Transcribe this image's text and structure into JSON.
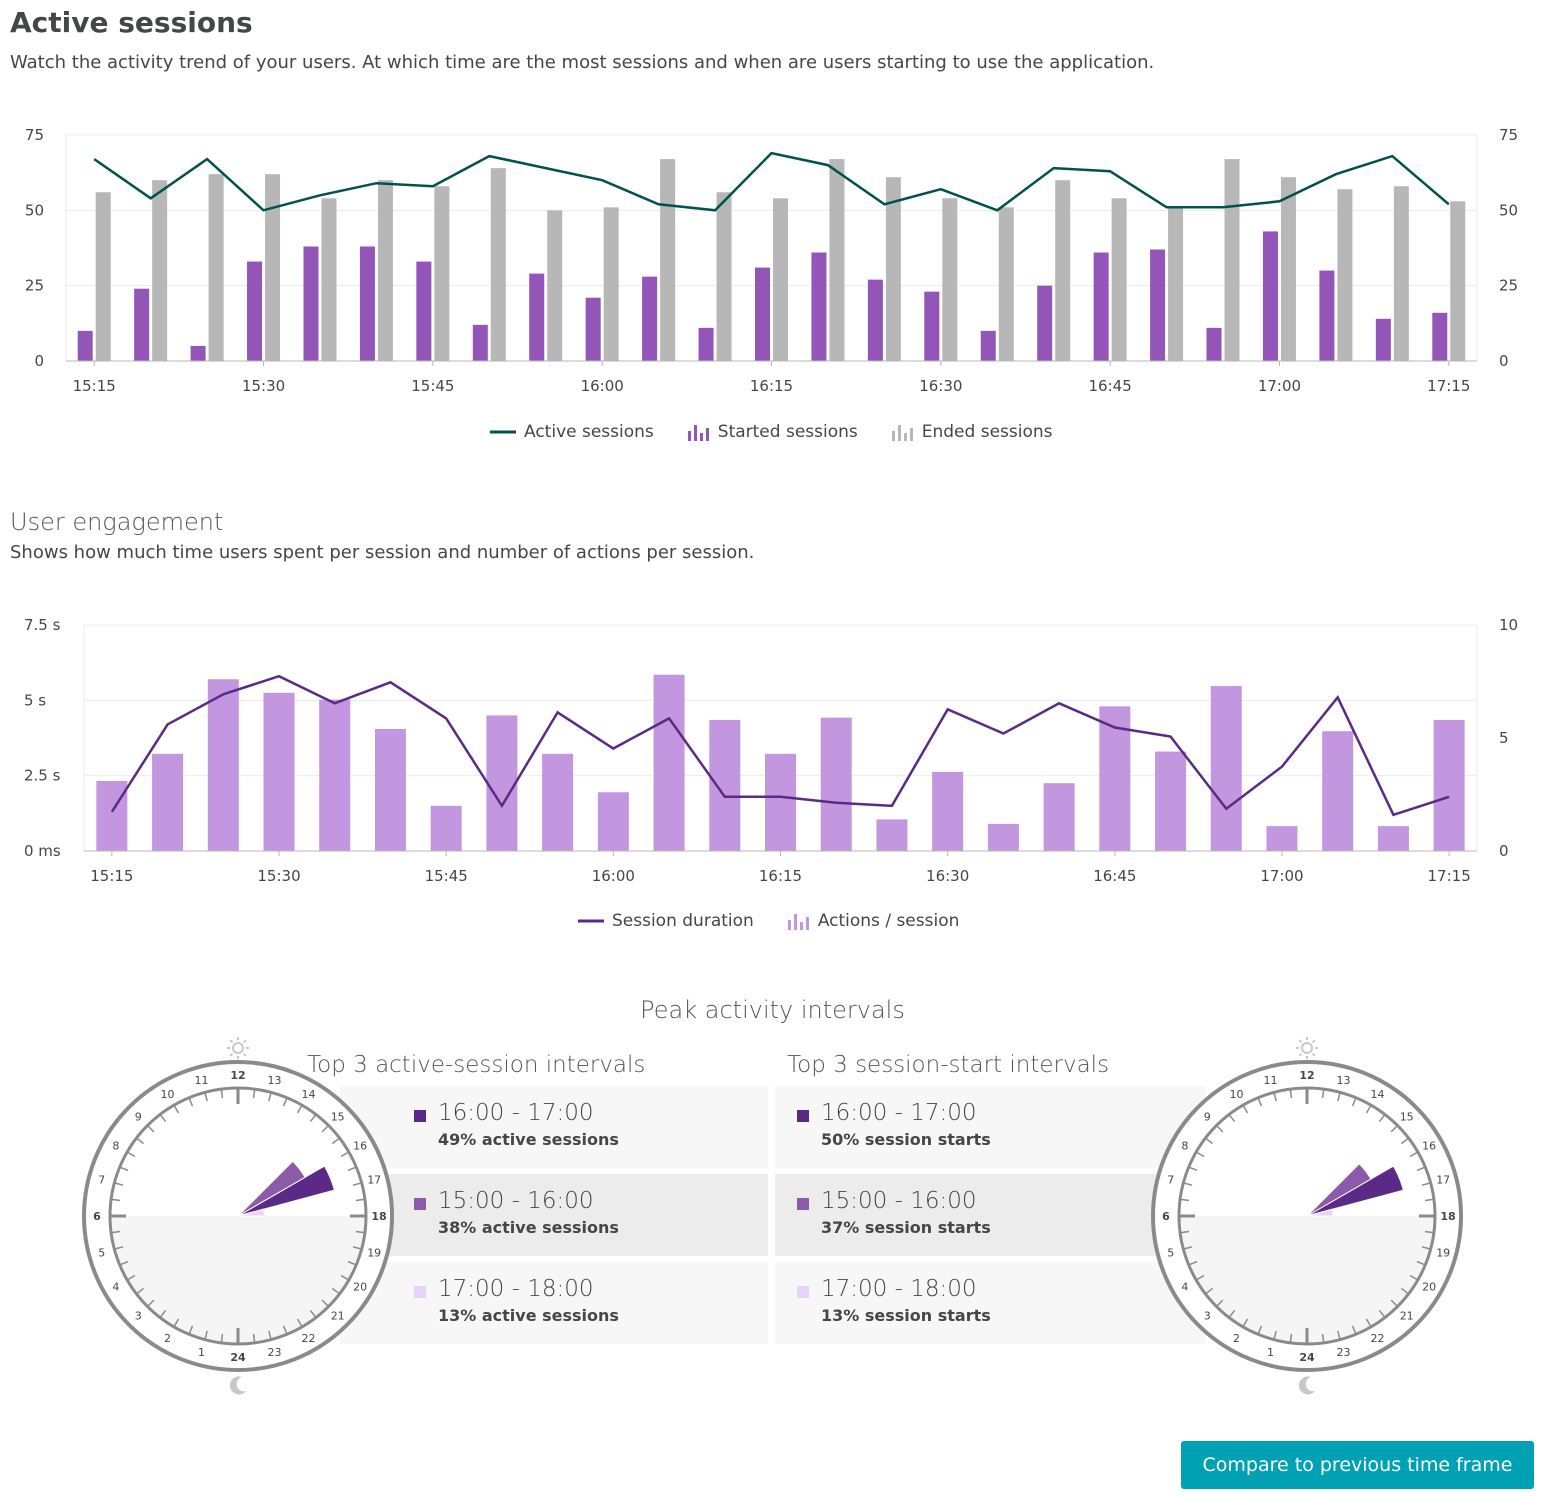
{
  "header": {
    "title": "Active sessions",
    "description": "Watch the activity trend of your users. At which time are the most sessions and when are users starting to use the application."
  },
  "engagement": {
    "title": "User engagement",
    "description": "Shows how much time users spent per session and number of actions per session."
  },
  "colors": {
    "active_line": "#00524f",
    "started_bar": "#9355b7",
    "ended_bar": "#b7b7b7",
    "duration_line": "#5b2a86",
    "actions_bar": "#c396e0",
    "peak_1": "#5b2a86",
    "peak_2": "#8c5aa9",
    "peak_3": "#e8d4fb",
    "button": "#00a1b2"
  },
  "chart_data": [
    {
      "type": "bar",
      "id": "active-sessions-chart",
      "x": [
        "15:15",
        "15:20",
        "15:25",
        "15:30",
        "15:35",
        "15:40",
        "15:45",
        "15:50",
        "15:55",
        "16:00",
        "16:05",
        "16:10",
        "16:15",
        "16:20",
        "16:25",
        "16:30",
        "16:35",
        "16:40",
        "16:45",
        "16:50",
        "16:55",
        "17:00",
        "17:05",
        "17:10",
        "17:15"
      ],
      "xticks": [
        "15:15",
        "15:30",
        "15:45",
        "16:00",
        "16:15",
        "16:30",
        "16:45",
        "17:00",
        "17:15"
      ],
      "yticks_left": [
        "0",
        "25",
        "50",
        "75"
      ],
      "yticks_right": [
        "0",
        "25",
        "50",
        "75"
      ],
      "ylim": [
        0,
        75
      ],
      "grid": true,
      "legend": "bottom",
      "series": [
        {
          "name": "Active sessions",
          "kind": "line",
          "values": [
            67,
            54,
            67,
            50,
            55,
            59,
            58,
            68,
            64,
            60,
            52,
            50,
            69,
            65,
            52,
            57,
            50,
            64,
            63,
            51,
            51,
            53,
            62,
            68,
            52
          ]
        },
        {
          "name": "Started sessions",
          "kind": "bar",
          "values": [
            10,
            24,
            5,
            33,
            38,
            38,
            33,
            12,
            29,
            21,
            28,
            11,
            31,
            36,
            27,
            23,
            10,
            25,
            36,
            37,
            11,
            43,
            30,
            14,
            16
          ]
        },
        {
          "name": "Ended sessions",
          "kind": "bar",
          "values": [
            56,
            60,
            62,
            62,
            54,
            60,
            58,
            64,
            50,
            51,
            67,
            56,
            54,
            67,
            61,
            54,
            51,
            60,
            54,
            51,
            67,
            61,
            57,
            58,
            53
          ]
        }
      ]
    },
    {
      "type": "bar",
      "id": "user-engagement-chart",
      "x": [
        "15:15",
        "15:20",
        "15:25",
        "15:30",
        "15:35",
        "15:40",
        "15:45",
        "15:50",
        "15:55",
        "16:00",
        "16:05",
        "16:10",
        "16:15",
        "16:20",
        "16:25",
        "16:30",
        "16:35",
        "16:40",
        "16:45",
        "16:50",
        "16:55",
        "17:00",
        "17:05",
        "17:10",
        "17:15"
      ],
      "xticks": [
        "15:15",
        "15:30",
        "15:45",
        "16:00",
        "16:15",
        "16:30",
        "16:45",
        "17:00",
        "17:15"
      ],
      "yticks_left": [
        "0 ms",
        "2.5 s",
        "5 s",
        "7.5 s"
      ],
      "yticks_right": [
        "0",
        "5",
        "10"
      ],
      "ylim_left": [
        0,
        7.5
      ],
      "ylim_right": [
        0,
        10
      ],
      "grid": true,
      "legend": "bottom",
      "series": [
        {
          "name": "Session duration",
          "kind": "line",
          "axis": "left",
          "values": [
            1.3,
            4.2,
            5.2,
            5.8,
            4.9,
            5.6,
            4.4,
            1.5,
            4.6,
            3.4,
            4.4,
            1.8,
            1.8,
            1.6,
            1.5,
            4.7,
            3.9,
            4.9,
            4.1,
            3.8,
            1.4,
            2.8,
            5.1,
            1.2,
            1.8
          ]
        },
        {
          "name": "Actions / session",
          "kind": "bar",
          "axis": "right",
          "values": [
            3.1,
            4.3,
            7.6,
            7.0,
            6.7,
            5.4,
            2.0,
            6.0,
            4.3,
            2.6,
            7.8,
            5.8,
            4.3,
            5.9,
            1.4,
            3.5,
            1.2,
            3.0,
            6.4,
            4.4,
            7.3,
            1.1,
            5.3,
            1.1,
            5.8
          ]
        }
      ]
    }
  ],
  "peak": {
    "title": "Peak activity intervals",
    "clock_hours": [
      "1",
      "2",
      "3",
      "4",
      "5",
      "6",
      "7",
      "8",
      "9",
      "10",
      "11",
      "12",
      "13",
      "14",
      "15",
      "16",
      "17",
      "18",
      "19",
      "20",
      "21",
      "22",
      "23",
      "24"
    ],
    "active": {
      "title": "Top 3 active-session intervals",
      "items": [
        {
          "range": "16:00 - 17:00",
          "pct": "49% active sessions",
          "share": 49,
          "start_hour": 16
        },
        {
          "range": "15:00 - 16:00",
          "pct": "38% active sessions",
          "share": 38,
          "start_hour": 15
        },
        {
          "range": "17:00 - 18:00",
          "pct": "13% active sessions",
          "share": 13,
          "start_hour": 17
        }
      ]
    },
    "starts": {
      "title": "Top 3 session-start intervals",
      "items": [
        {
          "range": "16:00 - 17:00",
          "pct": "50% session starts",
          "share": 50,
          "start_hour": 16
        },
        {
          "range": "15:00 - 16:00",
          "pct": "37% session starts",
          "share": 37,
          "start_hour": 15
        },
        {
          "range": "17:00 - 18:00",
          "pct": "13% session starts",
          "share": 13,
          "start_hour": 17
        }
      ]
    }
  },
  "actions": {
    "compare_label": "Compare to previous time frame"
  }
}
